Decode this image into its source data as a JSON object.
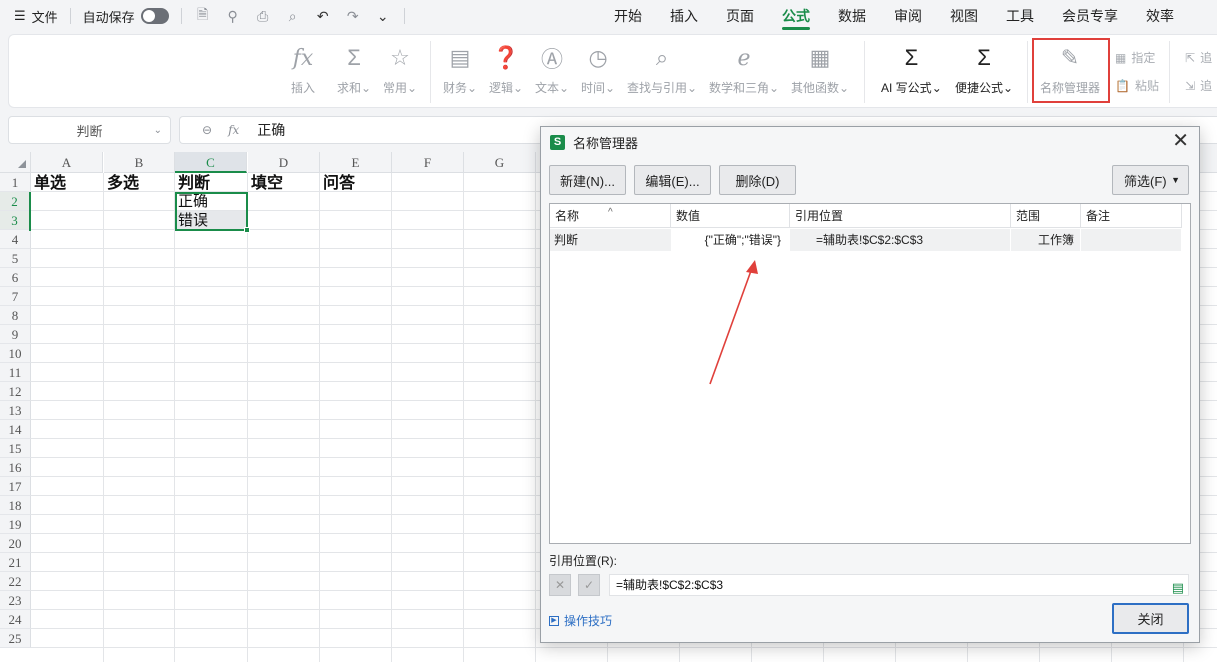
{
  "menubar": {
    "file_label": "文件",
    "autosave_label": "自动保存",
    "tabs": [
      "开始",
      "插入",
      "页面",
      "公式",
      "数据",
      "审阅",
      "视图",
      "工具",
      "会员专享",
      "效率"
    ],
    "active_tab": "公式"
  },
  "ribbon": {
    "insert": "插入",
    "sum": "求和",
    "common": "常用",
    "finance": "财务",
    "logic": "逻辑",
    "text": "文本",
    "time": "时间",
    "lookup": "查找与引用",
    "math": "数学和三角",
    "other": "其他函数",
    "ai_formula": "AI 写公式",
    "quick_formula": "便捷公式",
    "name_manager": "名称管理器",
    "assign": "指定",
    "paste": "粘贴",
    "trace1": "追",
    "trace2": "追"
  },
  "formula_bar": {
    "name_box": "判断",
    "fx_label": "fx",
    "value": "正确"
  },
  "grid": {
    "columns": [
      "A",
      "B",
      "C",
      "D",
      "E",
      "F",
      "G"
    ],
    "rows": [
      "1",
      "2",
      "3",
      "4",
      "5",
      "6",
      "7",
      "8",
      "9",
      "10",
      "11",
      "12",
      "13",
      "14",
      "15",
      "16",
      "17",
      "18",
      "19",
      "20",
      "21",
      "22",
      "23",
      "24",
      "25"
    ],
    "cells": {
      "A1": "单选",
      "B1": "多选",
      "C1": "判断",
      "D1": "填空",
      "E1": "问答",
      "C2": "正确",
      "C3": "错误"
    },
    "selected_column": "C",
    "accent": "#1a8c4a"
  },
  "dialog": {
    "logo": "S",
    "title": "名称管理器",
    "buttons": {
      "new": "新建(N)...",
      "edit": "编辑(E)...",
      "delete": "删除(D)",
      "filter": "筛选(F)",
      "close": "关闭"
    },
    "columns": [
      "名称",
      "数值",
      "引用位置",
      "范围",
      "备注"
    ],
    "rows": [
      {
        "name": "判断",
        "value": "{\"正确\";\"错误\"}",
        "ref": "=辅助表!$C$2:$C$3",
        "scope": "工作簿",
        "note": ""
      }
    ],
    "ref_label": "引用位置(R):",
    "ref_value": "=辅助表!$C$2:$C$3",
    "tips": "操作技巧",
    "highlight_color": "#e0403b"
  }
}
